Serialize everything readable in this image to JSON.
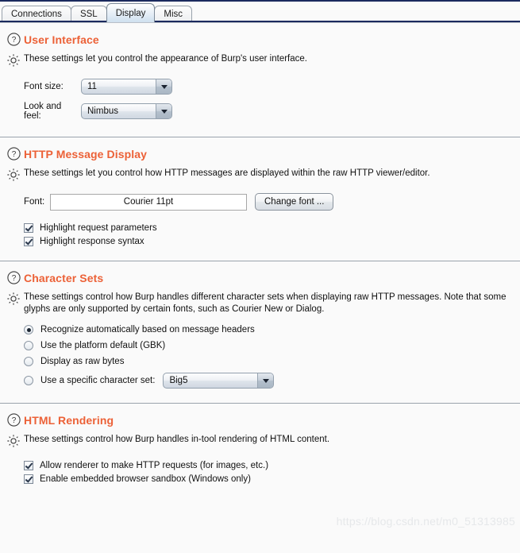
{
  "window": {
    "accent_color": "#ec6137",
    "border_color": "#1b2a5e"
  },
  "tabs": [
    {
      "label": "Connections",
      "selected": false
    },
    {
      "label": "SSL",
      "selected": false
    },
    {
      "label": "Display",
      "selected": true
    },
    {
      "label": "Misc",
      "selected": false
    }
  ],
  "sections": {
    "user_interface": {
      "title": "User Interface",
      "description": "These settings let you control the appearance of Burp's user interface.",
      "font_size": {
        "label": "Font size:",
        "value": "11"
      },
      "look_and_feel": {
        "label": "Look and feel:",
        "value": "Nimbus"
      }
    },
    "http_message_display": {
      "title": "HTTP Message Display",
      "description": "These settings let you control how HTTP messages are displayed within the raw HTTP viewer/editor.",
      "font": {
        "label": "Font:",
        "value": "Courier 11pt"
      },
      "change_font_button": "Change font ...",
      "checkboxes": [
        {
          "label": "Highlight request parameters",
          "checked": true
        },
        {
          "label": "Highlight response syntax",
          "checked": true
        }
      ]
    },
    "character_sets": {
      "title": "Character Sets",
      "description": "These settings control how Burp handles different character sets when displaying raw HTTP messages. Note that some glyphs are only supported by certain fonts, such as Courier New or Dialog.",
      "options": [
        {
          "label": "Recognize automatically based on message headers",
          "selected": true
        },
        {
          "label": "Use the platform default (GBK)",
          "selected": false
        },
        {
          "label": "Display as raw bytes",
          "selected": false
        },
        {
          "label": "Use a specific character set:",
          "selected": false
        }
      ],
      "charset_value": "Big5"
    },
    "html_rendering": {
      "title": "HTML Rendering",
      "description": "These settings control how Burp handles in-tool rendering of HTML content.",
      "checkboxes": [
        {
          "label": "Allow renderer to make HTTP requests (for images, etc.)",
          "checked": true
        },
        {
          "label": "Enable embedded browser sandbox (Windows only)",
          "checked": true
        }
      ]
    }
  },
  "watermark": "https://blog.csdn.net/m0_51313985",
  "icons": {
    "help": "question-circle-icon",
    "settings": "gear-icon",
    "dropdown": "chevron-down-icon"
  }
}
